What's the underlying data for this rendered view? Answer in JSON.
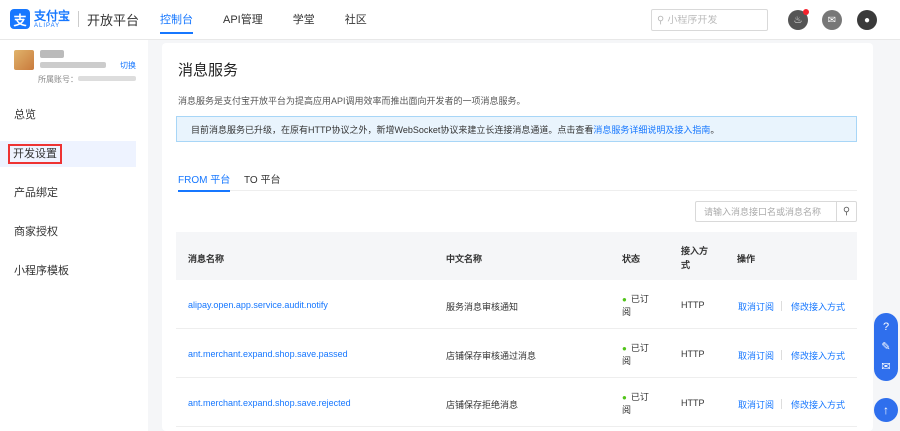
{
  "brand": {
    "mark": "支",
    "name_cn": "支付宝",
    "name_en": "ALIPAY",
    "platform": "开放平台"
  },
  "nav": {
    "items": [
      "控制台",
      "API管理",
      "学堂",
      "社区"
    ],
    "search_placeholder": "小程序开发"
  },
  "account": {
    "switch_label": "切换",
    "owner_label": "所属账号："
  },
  "sidebar": {
    "items": [
      "总览",
      "开发设置",
      "产品绑定",
      "商家授权",
      "小程序模板"
    ],
    "active_index": 1
  },
  "page": {
    "title": "消息服务",
    "description": "消息服务是支付宝开放平台为提高应用API调用效率而推出面向开发者的一项消息服务。",
    "notice_text": "目前消息服务已升级，在原有HTTP协议之外，新增WebSocket协议来建立长连接消息通道。点击查看",
    "notice_link": "消息服务详细说明及接入指南",
    "notice_end": "。"
  },
  "tabs": [
    "FROM 平台",
    "TO 平台"
  ],
  "msg_search_placeholder": "请输入消息接口名或消息名称",
  "table": {
    "headers": [
      "消息名称",
      "中文名称",
      "状态",
      "接入方式",
      "操作"
    ],
    "rows": [
      {
        "name": "alipay.open.app.service.audit.notify",
        "cn": "服务消息审核通知",
        "status": "已订阅",
        "method": "HTTP",
        "op1": "取消订阅",
        "op2": "修改接入方式"
      },
      {
        "name": "ant.merchant.expand.shop.save.passed",
        "cn": "店铺保存审核通过消息",
        "status": "已订阅",
        "method": "HTTP",
        "op1": "取消订阅",
        "op2": "修改接入方式"
      },
      {
        "name": "ant.merchant.expand.shop.save.rejected",
        "cn": "店铺保存拒绝消息",
        "status": "已订阅",
        "method": "HTTP",
        "op1": "取消订阅",
        "op2": "修改接入方式"
      }
    ]
  },
  "colors": {
    "accent": "#1677ff",
    "notice_bg": "#e9f4fd",
    "status_dot": "#52c41a",
    "highlight": "#e33"
  },
  "icons": [
    "search-icon",
    "bell-icon",
    "message-icon",
    "user-icon",
    "help-icon",
    "chat-icon",
    "feedback-icon",
    "arrow-up-icon"
  ]
}
